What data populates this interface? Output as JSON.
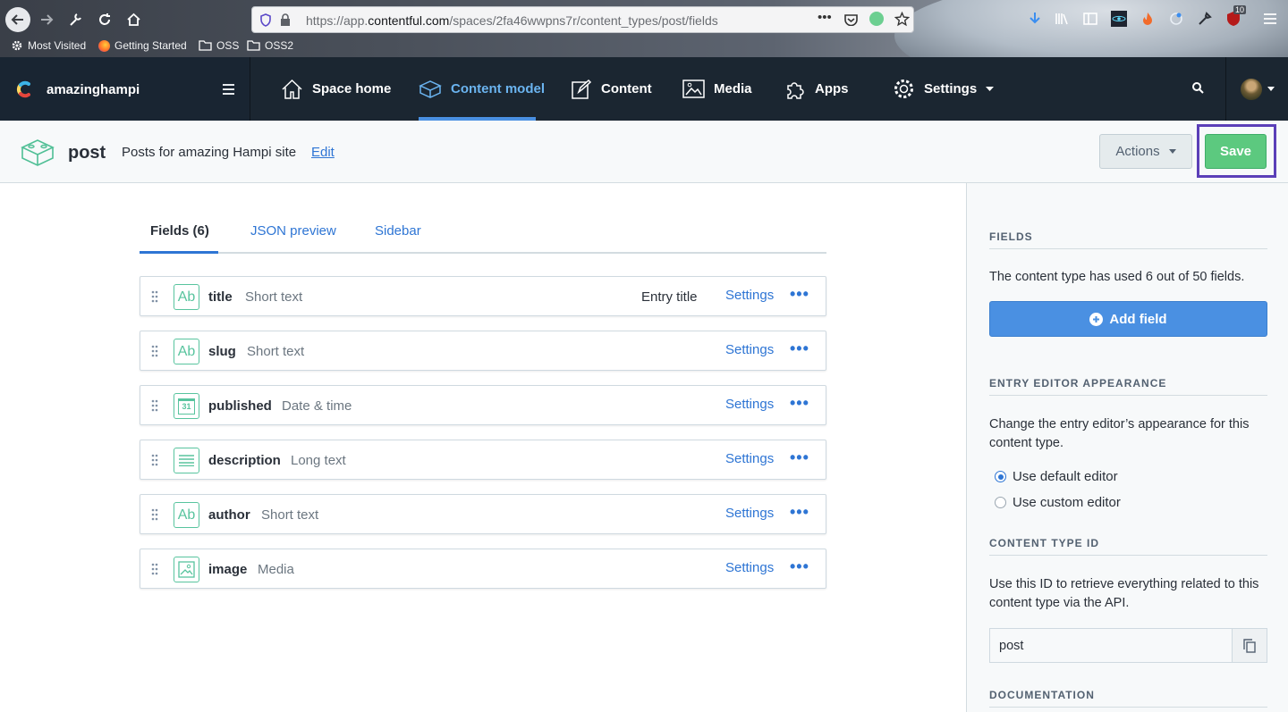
{
  "browser": {
    "url_prefix": "https://app.",
    "url_domain": "contentful.com",
    "url_path": "/spaces/2fa46wwpns7r/content_types/post/fields",
    "more_label": "•••",
    "bookmarks": [
      "Most Visited",
      "Getting Started",
      "OSS",
      "OSS2"
    ],
    "ext_badge": "10"
  },
  "appnav": {
    "space_name": "amazinghampi",
    "items": [
      {
        "label": "Space home",
        "icon": "home-icon"
      },
      {
        "label": "Content model",
        "icon": "cube-icon"
      },
      {
        "label": "Content",
        "icon": "edit-icon"
      },
      {
        "label": "Media",
        "icon": "image-icon"
      },
      {
        "label": "Apps",
        "icon": "puzzle-icon"
      },
      {
        "label": "Settings",
        "icon": "gear-icon"
      }
    ],
    "active_item": "Content model"
  },
  "header": {
    "content_type_name": "post",
    "description": "Posts for amazing Hampi site",
    "edit_label": "Edit",
    "actions_label": "Actions",
    "save_label": "Save"
  },
  "tabs": [
    "Fields (6)",
    "JSON preview",
    "Sidebar"
  ],
  "fields": [
    {
      "name": "title",
      "type": "Short text",
      "icon": "text-icon",
      "badge": "Entry title",
      "settings": "Settings",
      "more": "•••"
    },
    {
      "name": "slug",
      "type": "Short text",
      "icon": "text-icon",
      "badge": "",
      "settings": "Settings",
      "more": "•••"
    },
    {
      "name": "published",
      "type": "Date & time",
      "icon": "calendar-icon",
      "badge": "",
      "settings": "Settings",
      "more": "•••"
    },
    {
      "name": "description",
      "type": "Long text",
      "icon": "long-text-icon",
      "badge": "",
      "settings": "Settings",
      "more": "•••"
    },
    {
      "name": "author",
      "type": "Short text",
      "icon": "text-icon",
      "badge": "",
      "settings": "Settings",
      "more": "•••"
    },
    {
      "name": "image",
      "type": "Media",
      "icon": "media-icon",
      "badge": "",
      "settings": "Settings",
      "more": "•••"
    }
  ],
  "field_icon_text": "Ab",
  "calendar_day": "31",
  "sidebar": {
    "fields_heading": "FIELDS",
    "fields_text": "The content type has used 6 out of 50 fields.",
    "add_field_label": "Add field",
    "appearance_heading": "ENTRY EDITOR APPEARANCE",
    "appearance_text": "Change the entry editor’s appearance for this content type.",
    "option_default": "Use default editor",
    "option_custom": "Use custom editor",
    "ctid_heading": "CONTENT TYPE ID",
    "ctid_text": "Use this ID to retrieve everything related to this content type via the API.",
    "ctid_value": "post",
    "docs_heading": "DOCUMENTATION"
  },
  "colors": {
    "accent": "#2e75d4",
    "save_green": "#5cc97f",
    "field_icon": "#58c49e",
    "nav_bg": "#1b2631",
    "highlight_outline": "#5b3fb8"
  }
}
